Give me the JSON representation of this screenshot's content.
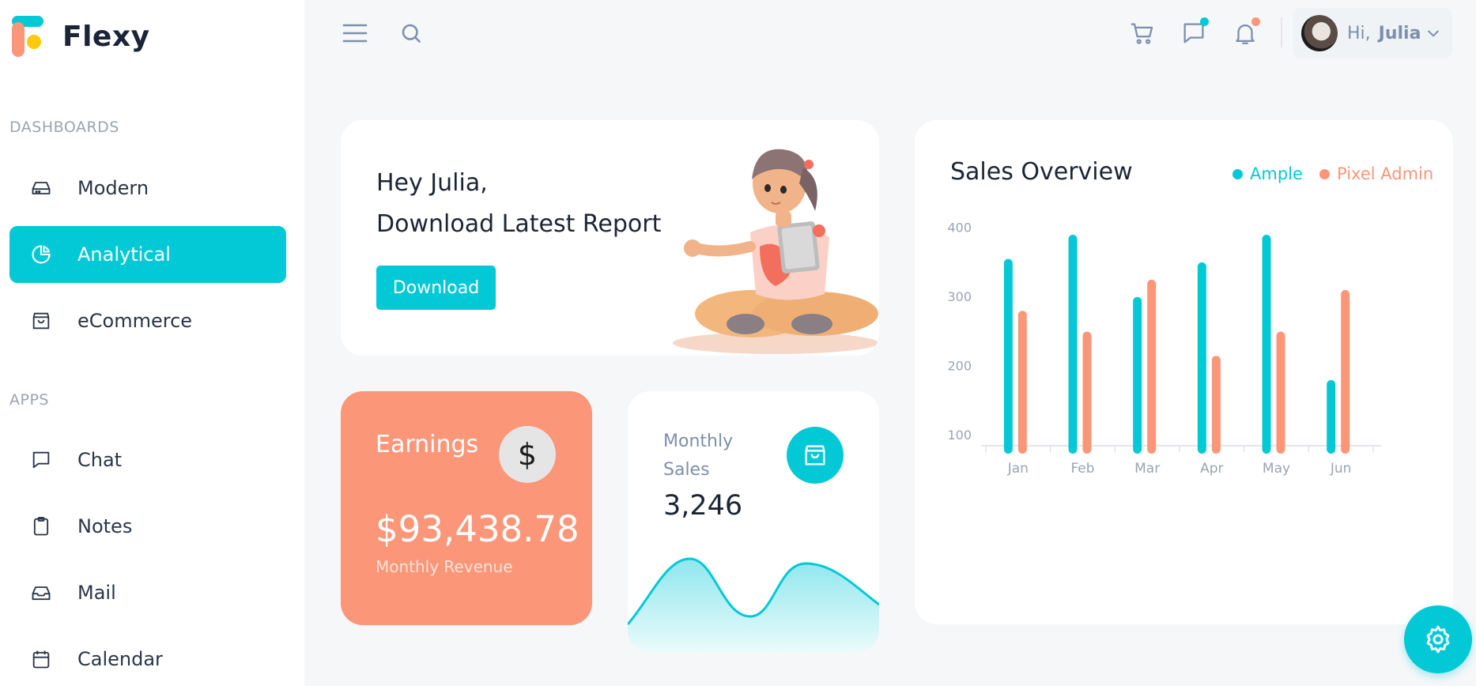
{
  "app": {
    "name": "Flexy"
  },
  "sidebar": {
    "sections": [
      {
        "title": "DASHBOARDS",
        "items": [
          {
            "label": "Modern",
            "icon": "dashboard-icon"
          },
          {
            "label": "Analytical",
            "icon": "pie-chart-icon",
            "active": true
          },
          {
            "label": "eCommerce",
            "icon": "shopping-bag-icon"
          }
        ]
      },
      {
        "title": "APPS",
        "items": [
          {
            "label": "Chat",
            "icon": "message-icon"
          },
          {
            "label": "Notes",
            "icon": "clipboard-icon"
          },
          {
            "label": "Mail",
            "icon": "inbox-icon"
          },
          {
            "label": "Calendar",
            "icon": "calendar-icon"
          }
        ]
      }
    ]
  },
  "topbar": {
    "greeting": "Hi,",
    "user": "Julia",
    "icons": [
      "menu-icon",
      "search-icon",
      "cart-icon",
      "chat-icon",
      "bell-icon"
    ]
  },
  "welcome": {
    "line1": "Hey Julia,",
    "line2": "Download Latest Report",
    "button": "Download"
  },
  "earnings": {
    "title": "Earnings",
    "icon_symbol": "$",
    "value": "$93,438.78",
    "subtitle": "Monthly Revenue"
  },
  "monthly_sales": {
    "title": "Monthly Sales",
    "value": "3,246"
  },
  "sales_overview": {
    "title": "Sales Overview",
    "legend": [
      {
        "name": "Ample",
        "color": "#03c9d7"
      },
      {
        "name": "Pixel Admin",
        "color": "#fb9678"
      }
    ]
  },
  "chart_data": {
    "type": "bar",
    "categories": [
      "Jan",
      "Feb",
      "Mar",
      "Apr",
      "May",
      "Jun"
    ],
    "series": [
      {
        "name": "Ample",
        "color": "#03c9d7",
        "values": [
          355,
          390,
          300,
          350,
          390,
          180
        ]
      },
      {
        "name": "Pixel Admin",
        "color": "#fb9678",
        "values": [
          280,
          250,
          325,
          215,
          250,
          310
        ]
      }
    ],
    "yticks": [
      100,
      200,
      300,
      400
    ],
    "ylim": [
      85,
      430
    ]
  },
  "colors": {
    "accent": "#03c9d7",
    "secondary": "#fb9678"
  }
}
